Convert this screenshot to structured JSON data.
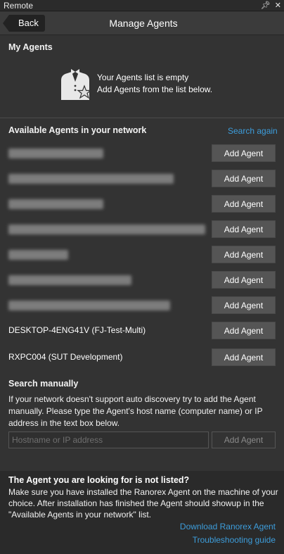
{
  "window": {
    "title": "Remote",
    "pin_glyph": "📌",
    "close_glyph": "✕"
  },
  "topbar": {
    "back_label": "Back",
    "title": "Manage Agents"
  },
  "my_agents": {
    "heading": "My Agents",
    "empty_title": "Your Agents list is empty",
    "empty_subtitle": "Add Agents from the list below."
  },
  "available": {
    "heading": "Available Agents in your network",
    "search_again_label": "Search again",
    "agents": [
      {
        "name": "",
        "redacted": true,
        "add_label": "Add Agent"
      },
      {
        "name": "",
        "redacted": true,
        "add_label": "Add Agent"
      },
      {
        "name": "",
        "redacted": true,
        "add_label": "Add Agent"
      },
      {
        "name": "",
        "redacted": true,
        "add_label": "Add Agent"
      },
      {
        "name": "",
        "redacted": true,
        "add_label": "Add Agent"
      },
      {
        "name": "",
        "redacted": true,
        "add_label": "Add Agent"
      },
      {
        "name": "",
        "redacted": true,
        "add_label": "Add Agent"
      },
      {
        "name": "DESKTOP-4ENG41V (FJ-Test-Multi)",
        "redacted": false,
        "add_label": "Add Agent"
      },
      {
        "name": "RXPC004 (SUT Development)",
        "redacted": false,
        "add_label": "Add Agent"
      }
    ]
  },
  "manual": {
    "heading": "Search manually",
    "description": "If your network doesn't support auto discovery try to add the Agent manually. Please type the Agent's host name (computer name) or IP address in the text box below.",
    "input_placeholder": "Hostname or IP address",
    "input_value": "",
    "add_label": "Add Agent"
  },
  "footer": {
    "heading": "The Agent you are looking for is not listed?",
    "text": "Make sure you have installed the Ranorex Agent on the machine of your choice. After installation has finished the Agent should showup in the \"Available Agents in your network\" list.",
    "download_label": "Download Ranorex Agent",
    "troubleshooting_label": "Troubleshooting guide"
  },
  "colors": {
    "background": "#333333",
    "link": "#3d9ddb",
    "button": "#555555",
    "footer_bg": "#2a2a2a"
  }
}
